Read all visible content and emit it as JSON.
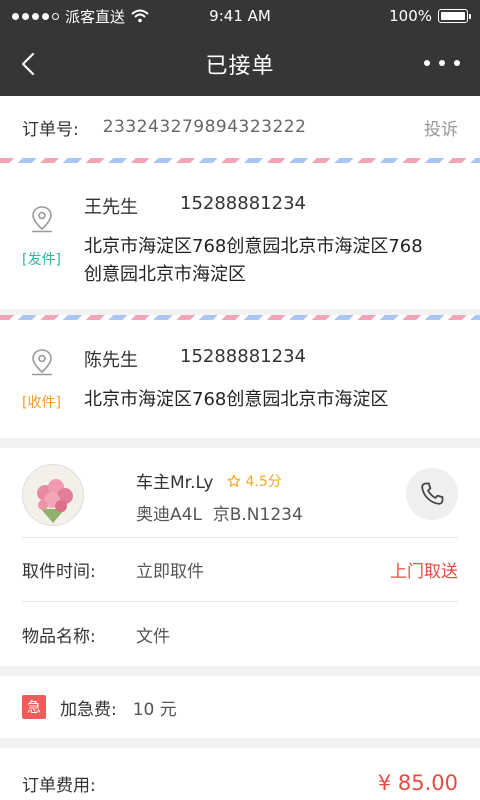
{
  "status_bar": {
    "carrier": "派客直送",
    "time": "9:41 AM",
    "battery": "100%"
  },
  "nav": {
    "title": "已接单",
    "back_icon": "chevron-left-icon",
    "more_icon": "more-dots-icon"
  },
  "order": {
    "label": "订单号:",
    "number": "233243279894323222",
    "complain": "投诉"
  },
  "sender": {
    "tag": "[发件]",
    "tag_color": "#2fb9a1",
    "name": "王先生",
    "phone": "15288881234",
    "address_line1": "北京市海淀区768创意园北京市海淀区768",
    "address_line2": "创意园北京市海淀区"
  },
  "receiver": {
    "tag": "[收件]",
    "tag_color": "#f39c32",
    "name": "陈先生",
    "phone": "15288881234",
    "address_line1": "北京市海淀区768创意园北京市海淀区"
  },
  "driver": {
    "name": "车主Mr.Ly",
    "rating": "4.5分",
    "car": "奥迪A4L  京B.N1234",
    "call_icon": "phone-icon"
  },
  "pickup": {
    "label": "取件时间:",
    "value": "立即取件",
    "mode": "上门取送"
  },
  "item": {
    "label": "物品名称:",
    "value": "文件"
  },
  "urgent": {
    "badge": "急",
    "label": "加急费:",
    "value": "10 元"
  },
  "fee": {
    "label": "订单费用:",
    "value": "¥ 85.00"
  },
  "colors": {
    "header": "#363636",
    "accent_red": "#e54d42",
    "rating": "#f5a623"
  }
}
